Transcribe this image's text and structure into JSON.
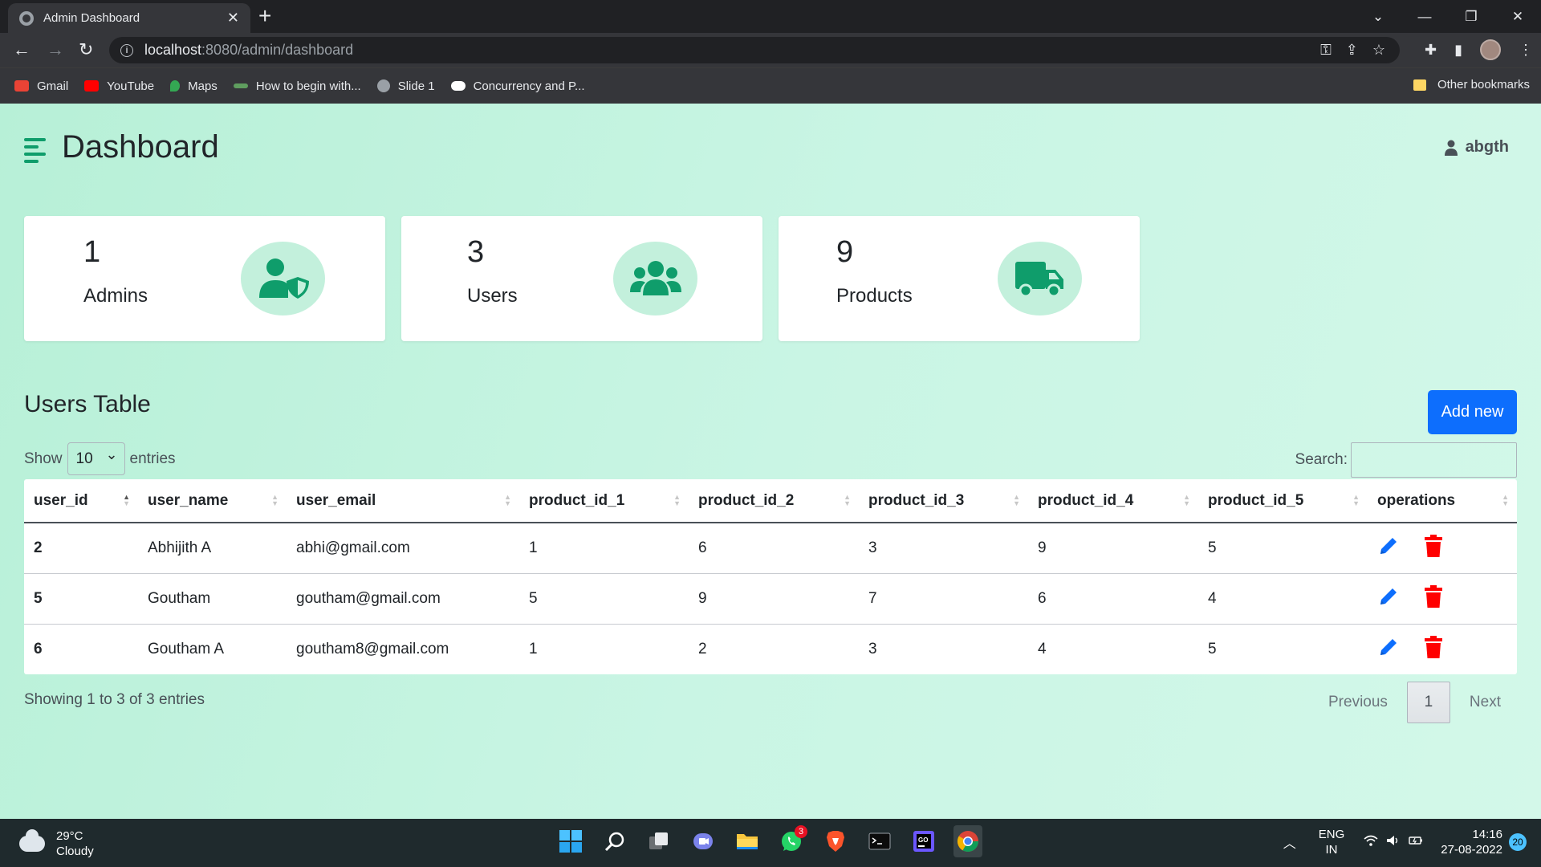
{
  "browser": {
    "tab_title": "Admin Dashboard",
    "tab_close": "✕",
    "new_tab": "+",
    "url_host": "localhost",
    "url_path": ":8080/admin/dashboard",
    "bookmarks": [
      {
        "label": "Gmail",
        "color": "#ea4335"
      },
      {
        "label": "YouTube",
        "color": "#ff0000"
      },
      {
        "label": "Maps",
        "color": "#34a853"
      },
      {
        "label": "How to begin with...",
        "color": "#5f9e5f"
      },
      {
        "label": "Slide 1",
        "color": "#9aa0a6"
      },
      {
        "label": "Concurrency and P...",
        "color": "#ffffff"
      }
    ],
    "other_bookmarks": "Other bookmarks"
  },
  "header": {
    "title": "Dashboard",
    "username": "abgth"
  },
  "cards": [
    {
      "count": "1",
      "label": "Admins",
      "icon": "user-shield-icon"
    },
    {
      "count": "3",
      "label": "Users",
      "icon": "users-icon"
    },
    {
      "count": "9",
      "label": "Products",
      "icon": "truck-icon"
    }
  ],
  "users_table": {
    "title": "Users Table",
    "add_button": "Add new",
    "show_label": "Show",
    "entries_label": "entries",
    "page_length": "10",
    "search_label": "Search:",
    "columns": [
      "user_id",
      "user_name",
      "user_email",
      "product_id_1",
      "product_id_2",
      "product_id_3",
      "product_id_4",
      "product_id_5",
      "operations"
    ],
    "rows": [
      {
        "user_id": "2",
        "user_name": "Abhijith A",
        "user_email": "abhi@gmail.com",
        "p1": "1",
        "p2": "6",
        "p3": "3",
        "p4": "9",
        "p5": "5"
      },
      {
        "user_id": "5",
        "user_name": "Goutham",
        "user_email": "goutham@gmail.com",
        "p1": "5",
        "p2": "9",
        "p3": "7",
        "p4": "6",
        "p5": "4"
      },
      {
        "user_id": "6",
        "user_name": "Goutham A",
        "user_email": "goutham8@gmail.com",
        "p1": "1",
        "p2": "2",
        "p3": "3",
        "p4": "4",
        "p5": "5"
      }
    ],
    "info": "Showing 1 to 3 of 3 entries",
    "pagination": {
      "previous": "Previous",
      "current": "1",
      "next": "Next"
    }
  },
  "colors": {
    "accent_green": "#0f9d6b",
    "edit_blue": "#0d6efd",
    "delete_red": "#ff0000"
  },
  "taskbar": {
    "temperature": "29°C",
    "weather": "Cloudy",
    "whatsapp_badge": "3",
    "lang_top": "ENG",
    "lang_bottom": "IN",
    "time": "14:16",
    "date": "27-08-2022",
    "notifications": "20"
  }
}
